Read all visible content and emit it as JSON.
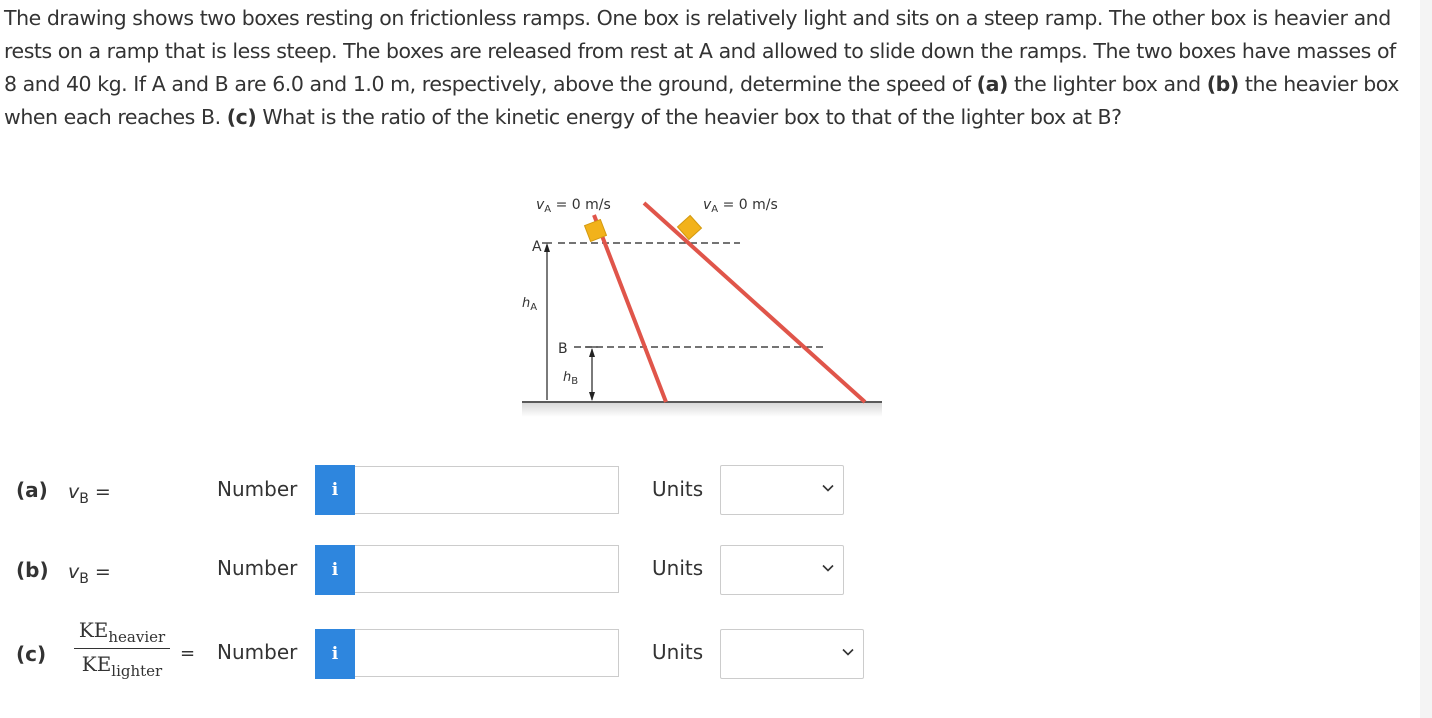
{
  "problem": {
    "text_1": "The drawing shows two boxes resting on frictionless ramps. One box is relatively light and sits on a steep ramp. The other box is heavier and rests on a ramp that is less steep. The boxes are released from rest at A and allowed to slide down the ramps. The two boxes have masses of 8 and 40 kg. If A and B are 6.0 and 1.0 m, respectively, above the ground, determine the speed of ",
    "part_a": "(a)",
    "text_2": " the lighter box and ",
    "part_b": "(b)",
    "text_3": " the heavier box when each reaches B. ",
    "part_c": "(c)",
    "text_4": " What is the ratio of the kinetic energy of the heavier box to that of the lighter box at B?"
  },
  "figure": {
    "va_left": "v",
    "va_left_sub": "A",
    "va_left_rest": " = 0 m/s",
    "va_right": "v",
    "va_right_sub": "A",
    "va_right_rest": " = 0 m/s",
    "label_a": "A",
    "label_ha": "h",
    "label_ha_sub": "A",
    "label_b": "B",
    "label_hb": "h",
    "label_hb_sub": "B",
    "colors": {
      "ramp": "#e0554a",
      "box": "#f2b21b",
      "ground": "#5a5a5a"
    }
  },
  "rows": {
    "a": {
      "part": "(a)",
      "var": "v",
      "var_sub": "B",
      "eq": " =",
      "number_label": "Number",
      "units_label": "Units",
      "value": ""
    },
    "b": {
      "part": "(b)",
      "var": "v",
      "var_sub": "B",
      "eq": " =",
      "number_label": "Number",
      "units_label": "Units",
      "value": ""
    },
    "c": {
      "part": "(c)",
      "ke_num": "KE",
      "ke_num_sub": "heavier",
      "ke_den": "KE",
      "ke_den_sub": "lighter",
      "eq": "=",
      "number_label": "Number",
      "units_label": "Units",
      "value": ""
    }
  },
  "icons": {
    "info": "info-icon",
    "chevron": "chevron-down-icon"
  },
  "info_glyph": "i",
  "accent_color": "#2e86de"
}
